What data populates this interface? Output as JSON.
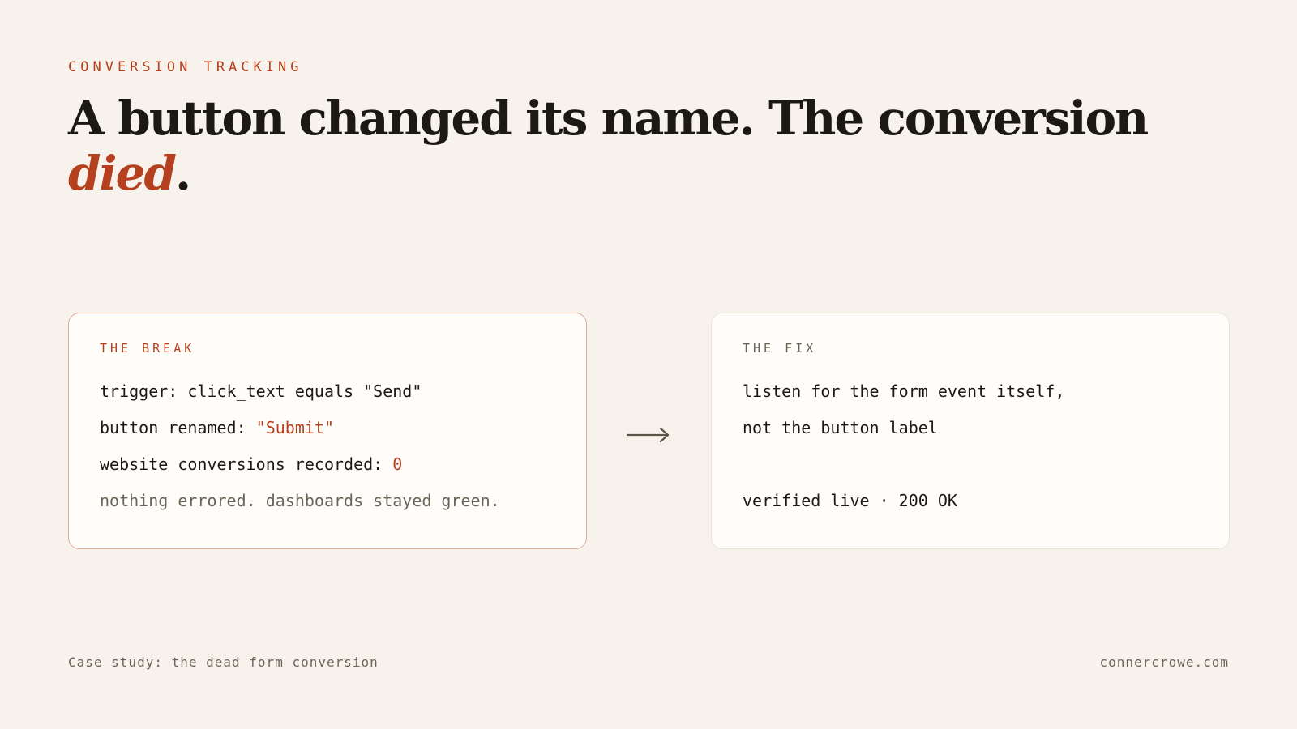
{
  "eyebrow": "CONVERSION TRACKING",
  "headline": {
    "main": "A button changed its name. The conversion ",
    "accent": "died",
    "end": "."
  },
  "break_card": {
    "label": "THE BREAK",
    "line1": "trigger: click_text equals \"Send\"",
    "line2_prefix": "button renamed: ",
    "line2_value": "\"Submit\"",
    "line3_prefix": "website conversions recorded: ",
    "line3_value": "0",
    "line4": "nothing errored. dashboards stayed green."
  },
  "arrow_icon": "arrow-right-icon",
  "fix_card": {
    "label": "THE FIX",
    "line1": "listen for the form event itself,",
    "line2": "not the button label",
    "line3": "verified live · 200 OK"
  },
  "footer": {
    "left": "Case study: the dead form conversion",
    "right": "connercrowe.com"
  },
  "colors": {
    "background": "#f7f3ec",
    "accent": "#b5401f",
    "text": "#1c1914",
    "muted": "#6b6459"
  }
}
